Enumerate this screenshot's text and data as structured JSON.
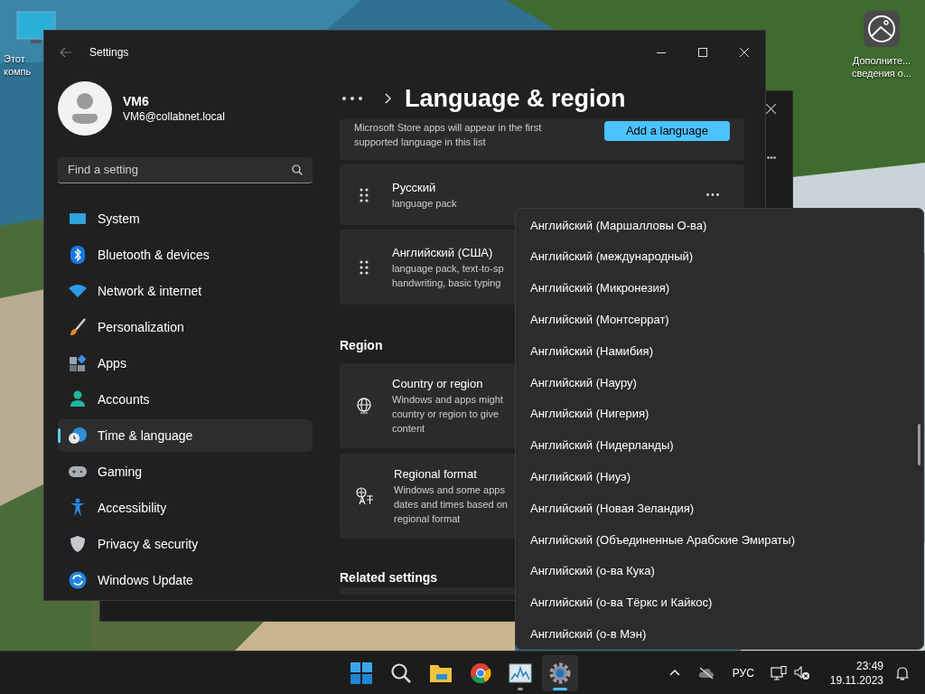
{
  "desktop": {
    "icons": [
      {
        "kind": "computer",
        "label": "Этот\nкомпь"
      },
      {
        "kind": "info",
        "label": "Дополните...\nсведения о..."
      }
    ]
  },
  "settings": {
    "title": "Settings",
    "user": {
      "name": "VM6",
      "email": "VM6@collabnet.local"
    },
    "search": {
      "placeholder": "Find a setting"
    },
    "nav": [
      {
        "label": "System",
        "selected": false
      },
      {
        "label": "Bluetooth & devices",
        "selected": false
      },
      {
        "label": "Network & internet",
        "selected": false
      },
      {
        "label": "Personalization",
        "selected": false
      },
      {
        "label": "Apps",
        "selected": false
      },
      {
        "label": "Accounts",
        "selected": false
      },
      {
        "label": "Time & language",
        "selected": true
      },
      {
        "label": "Gaming",
        "selected": false
      },
      {
        "label": "Accessibility",
        "selected": false
      },
      {
        "label": "Privacy & security",
        "selected": false
      },
      {
        "label": "Windows Update",
        "selected": false
      }
    ],
    "page_title": "Language & region",
    "store_note": {
      "text": "Microsoft Store apps will appear in the first\nsupported language in this list",
      "button": "Add a language"
    },
    "languages": [
      {
        "name": "Русский",
        "details": "language pack",
        "menu": true
      },
      {
        "name": "Английский (США)",
        "details": "language pack, text-to-sp\nhandwriting, basic typing"
      }
    ],
    "region": {
      "heading": "Region",
      "cards": [
        {
          "kind": "globe",
          "title": "Country or region",
          "details": "Windows and apps might\ncountry or region to give\ncontent"
        },
        {
          "kind": "format",
          "title": "Regional format",
          "details": "Windows and some apps\ndates and times based on\nregional format"
        }
      ]
    },
    "related_heading": "Related settings"
  },
  "dropdown": {
    "items": [
      "Английский (Маршалловы О-ва)",
      "Английский (международный)",
      "Английский (Микронезия)",
      "Английский (Монтсеррат)",
      "Английский (Намибия)",
      "Английский (Науру)",
      "Английский (Нигерия)",
      "Английский (Нидерланды)",
      "Английский (Ниуэ)",
      "Английский (Новая Зеландия)",
      "Английский (Объединенные Арабские Эмираты)",
      "Английский (о-ва Кука)",
      "Английский (о-ва Тёркс и Кайкос)",
      "Английский (о-в Мэн)"
    ]
  },
  "taskbar": {
    "apps": [
      {
        "kind": "start",
        "running": false,
        "selected": false
      },
      {
        "kind": "search",
        "running": false,
        "selected": false
      },
      {
        "kind": "folder",
        "running": false,
        "selected": false
      },
      {
        "kind": "browser",
        "running": false,
        "selected": false
      },
      {
        "kind": "monitor",
        "running": true,
        "selected": false
      },
      {
        "kind": "settings",
        "running": true,
        "selected": true
      }
    ],
    "language": "РУС",
    "time": "23:49",
    "date": "19.11.2023"
  }
}
